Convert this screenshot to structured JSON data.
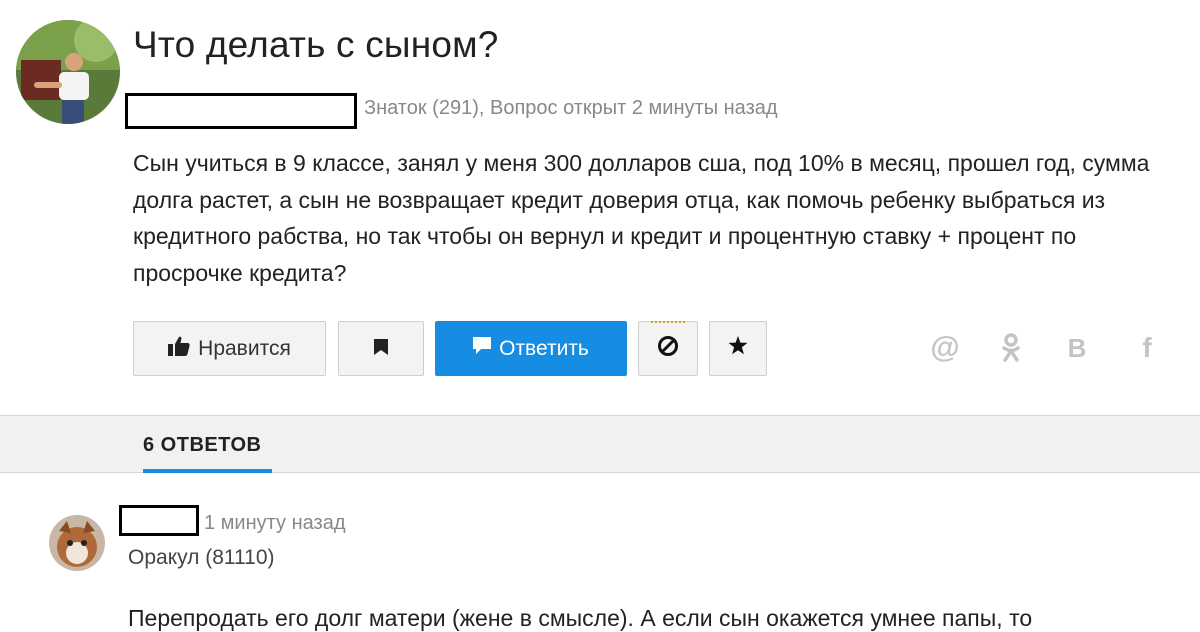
{
  "question": {
    "title": "Что делать с сыном?",
    "author_meta": "Знаток (291), Вопрос открыт 2 минуты назад",
    "body": "Сын учиться в 9 классе, занял у меня 300 долларов сша, под 10% в месяц, прошел год, сумма долга растет, а сын не возвращает кредит доверия отца, как помочь ребенку выбраться из кредитного рабства, но так чтобы он вернул и кредит и процентную ставку + процент по просрочке кредита?"
  },
  "actions": {
    "like_label": "Нравится",
    "reply_label": "Ответить"
  },
  "share": {
    "mail": "@",
    "vk": "B",
    "fb": "f"
  },
  "answers_tab": {
    "label": "6 ОТВЕТОВ"
  },
  "answer": {
    "time": "1 минуту назад",
    "rank": "Оракул (81110)",
    "text": "Перепродать его долг матери (жене в смысле). А если сын окажется умнее папы, то"
  },
  "colors": {
    "accent": "#168de2",
    "muted_text": "#888888",
    "button_bg": "#f3f3f3"
  },
  "icons": [
    "thumbs-up-icon",
    "bookmark-icon",
    "comment-icon",
    "block-icon",
    "star-icon",
    "mail-ru-icon",
    "odnoklassniki-icon",
    "vk-icon",
    "facebook-icon"
  ]
}
